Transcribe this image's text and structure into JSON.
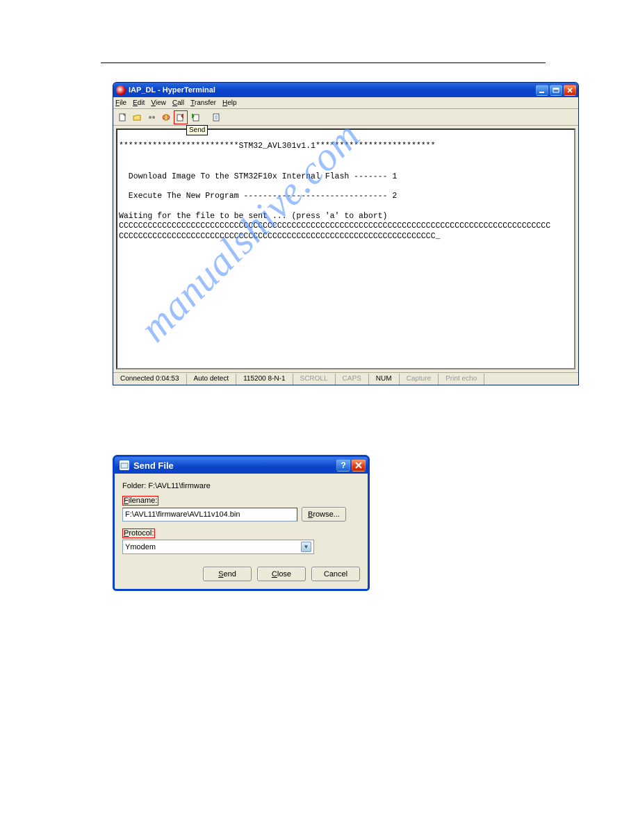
{
  "watermark_text": "manualshive.com",
  "hyperterminal": {
    "title": "IAP_DL - HyperTerminal",
    "menus": [
      "File",
      "Edit",
      "View",
      "Call",
      "Transfer",
      "Help"
    ],
    "tooltip": "Send",
    "terminal_lines": [
      "",
      "*************************STM32_AVL301v1.1*************************",
      "",
      "",
      "  Download Image To the STM32F10x Internal Flash ------- 1",
      "",
      "  Execute The New Program ------------------------------ 2",
      "",
      "Waiting for the file to be sent ... (press 'a' to abort)",
      "CCCCCCCCCCCCCCCCCCCCCCCCCCCCCCCCCCCCCCCCCCCCCCCCCCCCCCCCCCCCCCCCCCCCCCCCCCCCCCCCCCCCCCCCCC",
      "CCCCCCCCCCCCCCCCCCCCCCCCCCCCCCCCCCCCCCCCCCCCCCCCCCCCCCCCCCCCCCCCCC_"
    ],
    "status": {
      "connected": "Connected 0:04:53",
      "autodetect": "Auto detect",
      "baud": "115200 8-N-1",
      "scroll": "SCROLL",
      "caps": "CAPS",
      "num": "NUM",
      "capture": "Capture",
      "print_echo": "Print echo"
    },
    "toolbar_icons": [
      "new",
      "open",
      "connect",
      "disconnect",
      "send",
      "receive",
      "properties"
    ]
  },
  "sendfile": {
    "title": "Send File",
    "folder_label": "Folder:",
    "folder_value": "F:\\AVL11\\firmware",
    "filename_label": "Filename:",
    "filename_value": "F:\\AVL11\\firmware\\AVL11v104.bin",
    "browse": "Browse...",
    "protocol_label": "Protocol:",
    "protocol_value": "Ymodem",
    "btn_send": "Send",
    "btn_close": "Close",
    "btn_cancel": "Cancel"
  }
}
